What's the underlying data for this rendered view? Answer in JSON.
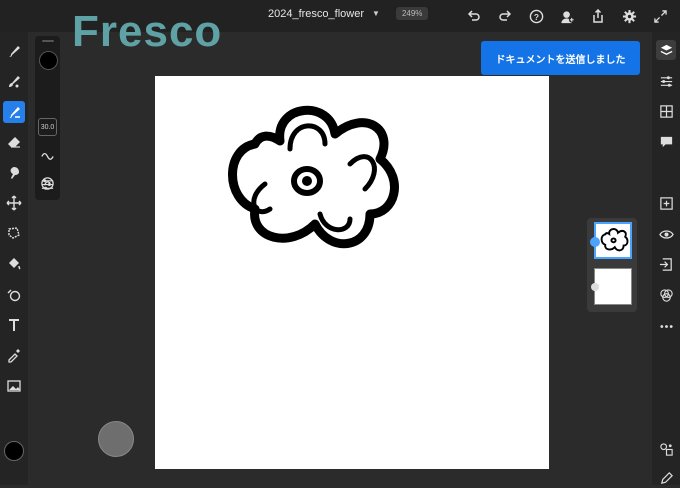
{
  "app": {
    "brand_watermark": "Fresco",
    "document_title": "2024_fresco_flower",
    "zoom": "249%"
  },
  "brush": {
    "size": "30.0",
    "color": "#000000"
  },
  "notification": {
    "text": "ドキュメントを送信しました"
  },
  "colors": {
    "accent": "#2680eb",
    "toast": "#1473e6",
    "brand": "#5fa2a6"
  },
  "left_tools": [
    {
      "name": "pixel-brush",
      "icon": "pixel-brush-icon"
    },
    {
      "name": "live-brush",
      "icon": "live-brush-icon"
    },
    {
      "name": "vector-brush",
      "icon": "vector-brush-icon",
      "active": true
    },
    {
      "name": "eraser",
      "icon": "eraser-icon"
    },
    {
      "name": "smudge",
      "icon": "smudge-icon"
    },
    {
      "name": "move",
      "icon": "move-icon"
    },
    {
      "name": "lasso",
      "icon": "lasso-icon"
    },
    {
      "name": "fill",
      "icon": "fill-icon"
    },
    {
      "name": "shape",
      "icon": "shape-icon"
    },
    {
      "name": "text",
      "icon": "text-icon"
    },
    {
      "name": "eyedropper",
      "icon": "eyedropper-icon"
    },
    {
      "name": "place-image",
      "icon": "image-icon"
    }
  ],
  "right_tools": [
    "layers-icon",
    "adjustments-icon",
    "grid-icon",
    "comment-icon",
    "add-layer-icon",
    "visibility-icon",
    "import-icon",
    "blend-icon",
    "more-icon",
    "layer-properties-icon",
    "edit-icon"
  ]
}
